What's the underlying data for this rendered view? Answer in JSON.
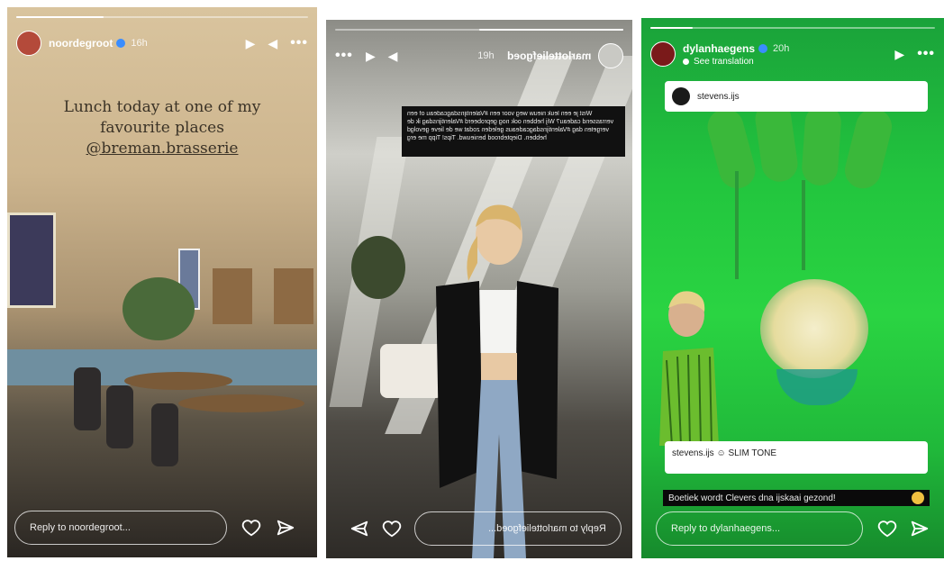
{
  "stories": [
    {
      "username": "noordegroot",
      "time": "16h",
      "progress": 0.3,
      "caption_lines": [
        "Lunch today at one of my",
        "favourite places"
      ],
      "caption_mention": "@breman.brasserie",
      "reply_placeholder": "Reply to noordegroot..."
    },
    {
      "username": "marlotteliefgoed",
      "time": "19h",
      "progress": 0.5,
      "caption_text": "Wist je een leuk nieuw weg voor een #Valentijnsdagcadeau of een verrassend cadeau? Wij hebben ook nog geprobeerd #Valentijnsdag ik de vergeten dag #Valentijnsdagcadeaus geleden zodat we de lieve gevolgd hebben. Dieptebrood benieuwd. Tips! Tipp me erg",
      "reply_placeholder": "Reply to marlotteliefgoed..."
    },
    {
      "username": "dylanhaegens",
      "time": "20h",
      "see_translation": "See translation",
      "progress": 0.15,
      "sticker_top_user": "stevens.ijs",
      "sticker_bottom_text": "stevens.ijs ☺ SLIM TONE",
      "caption_text": "Boetiek wordt Clevers dna ijskaai gezond!",
      "reply_placeholder": "Reply to dylanhaegens..."
    }
  ],
  "icons": {
    "play": "play-icon",
    "mute": "speaker-icon",
    "more": "more-icon",
    "like": "heart-icon",
    "share": "send-icon",
    "verified": "verified-badge-icon"
  },
  "colors": {
    "verified": "#3a8dff",
    "story3_bg": "#22c53e"
  }
}
